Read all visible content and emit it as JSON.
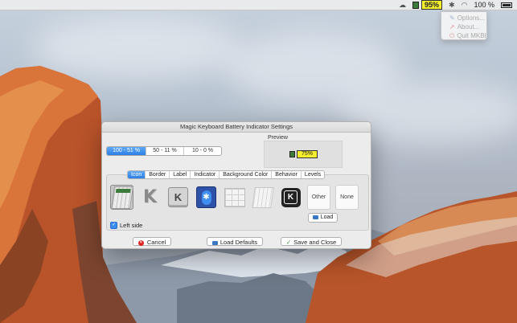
{
  "menubar": {
    "battery_percent_text": "95%",
    "system_battery_text": "100 %",
    "icons": [
      "cloud-icon",
      "keyboard-battery-icon",
      "bluetooth-icon",
      "wifi-icon",
      "battery-icon"
    ]
  },
  "status_menu": {
    "items": [
      {
        "label": "Options...",
        "icon": "wrench-icon"
      },
      {
        "label": "About...",
        "icon": "rocket-icon"
      },
      {
        "label": "Quit MKBI",
        "icon": "power-icon"
      }
    ]
  },
  "window": {
    "title": "Magic Keyboard Battery Indicator Settings",
    "levels": [
      "100 - 51 %",
      "50 - 11 %",
      "10 - 0 %"
    ],
    "preview_label": "Preview",
    "preview_text": "75%",
    "tabs": [
      "Icon",
      "Border",
      "Label",
      "Indicator",
      "Background Color",
      "Behavior",
      "Levels"
    ],
    "icon_options_text": [
      "Other",
      "None"
    ],
    "load_label": "Load",
    "left_side_label": "Left side",
    "left_side_checked": true,
    "buttons": {
      "cancel": "Cancel",
      "load_defaults": "Load Defaults",
      "save_close": "Save and Close"
    }
  },
  "colors": {
    "accent": "#2d7fe6",
    "indicator_yellow": "#f4ee2c",
    "indicator_green": "#3d7b3a"
  }
}
